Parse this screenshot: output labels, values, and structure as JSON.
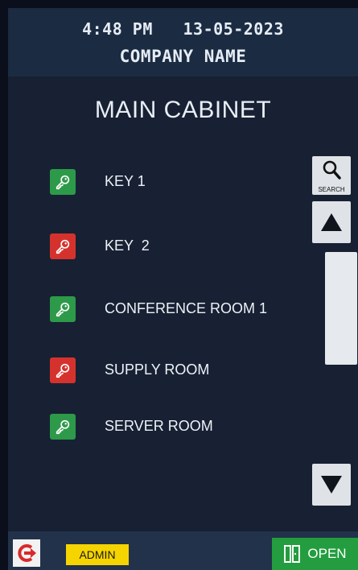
{
  "header": {
    "time": "4:48 PM",
    "date": "13-05-2023",
    "company": "COMPANY NAME"
  },
  "title": "MAIN CABINET",
  "keys": [
    {
      "label": "KEY 1",
      "status": "available"
    },
    {
      "label": "KEY  2",
      "status": "taken"
    },
    {
      "label": "CONFERENCE ROOM 1",
      "status": "available"
    },
    {
      "label": "SUPPLY ROOM",
      "status": "taken"
    },
    {
      "label": "SERVER ROOM",
      "status": "available"
    }
  ],
  "search": {
    "label": "SEARCH",
    "icon": "search-icon"
  },
  "footer": {
    "admin_label": "ADMIN",
    "open_label": "OPEN",
    "logout_icon": "logout-icon",
    "open_icon": "door-open-icon"
  },
  "colors": {
    "available": "#2d9a4a",
    "taken": "#d6322d",
    "admin": "#f5d400",
    "open": "#239d3f",
    "logout": "#d82a2a"
  }
}
